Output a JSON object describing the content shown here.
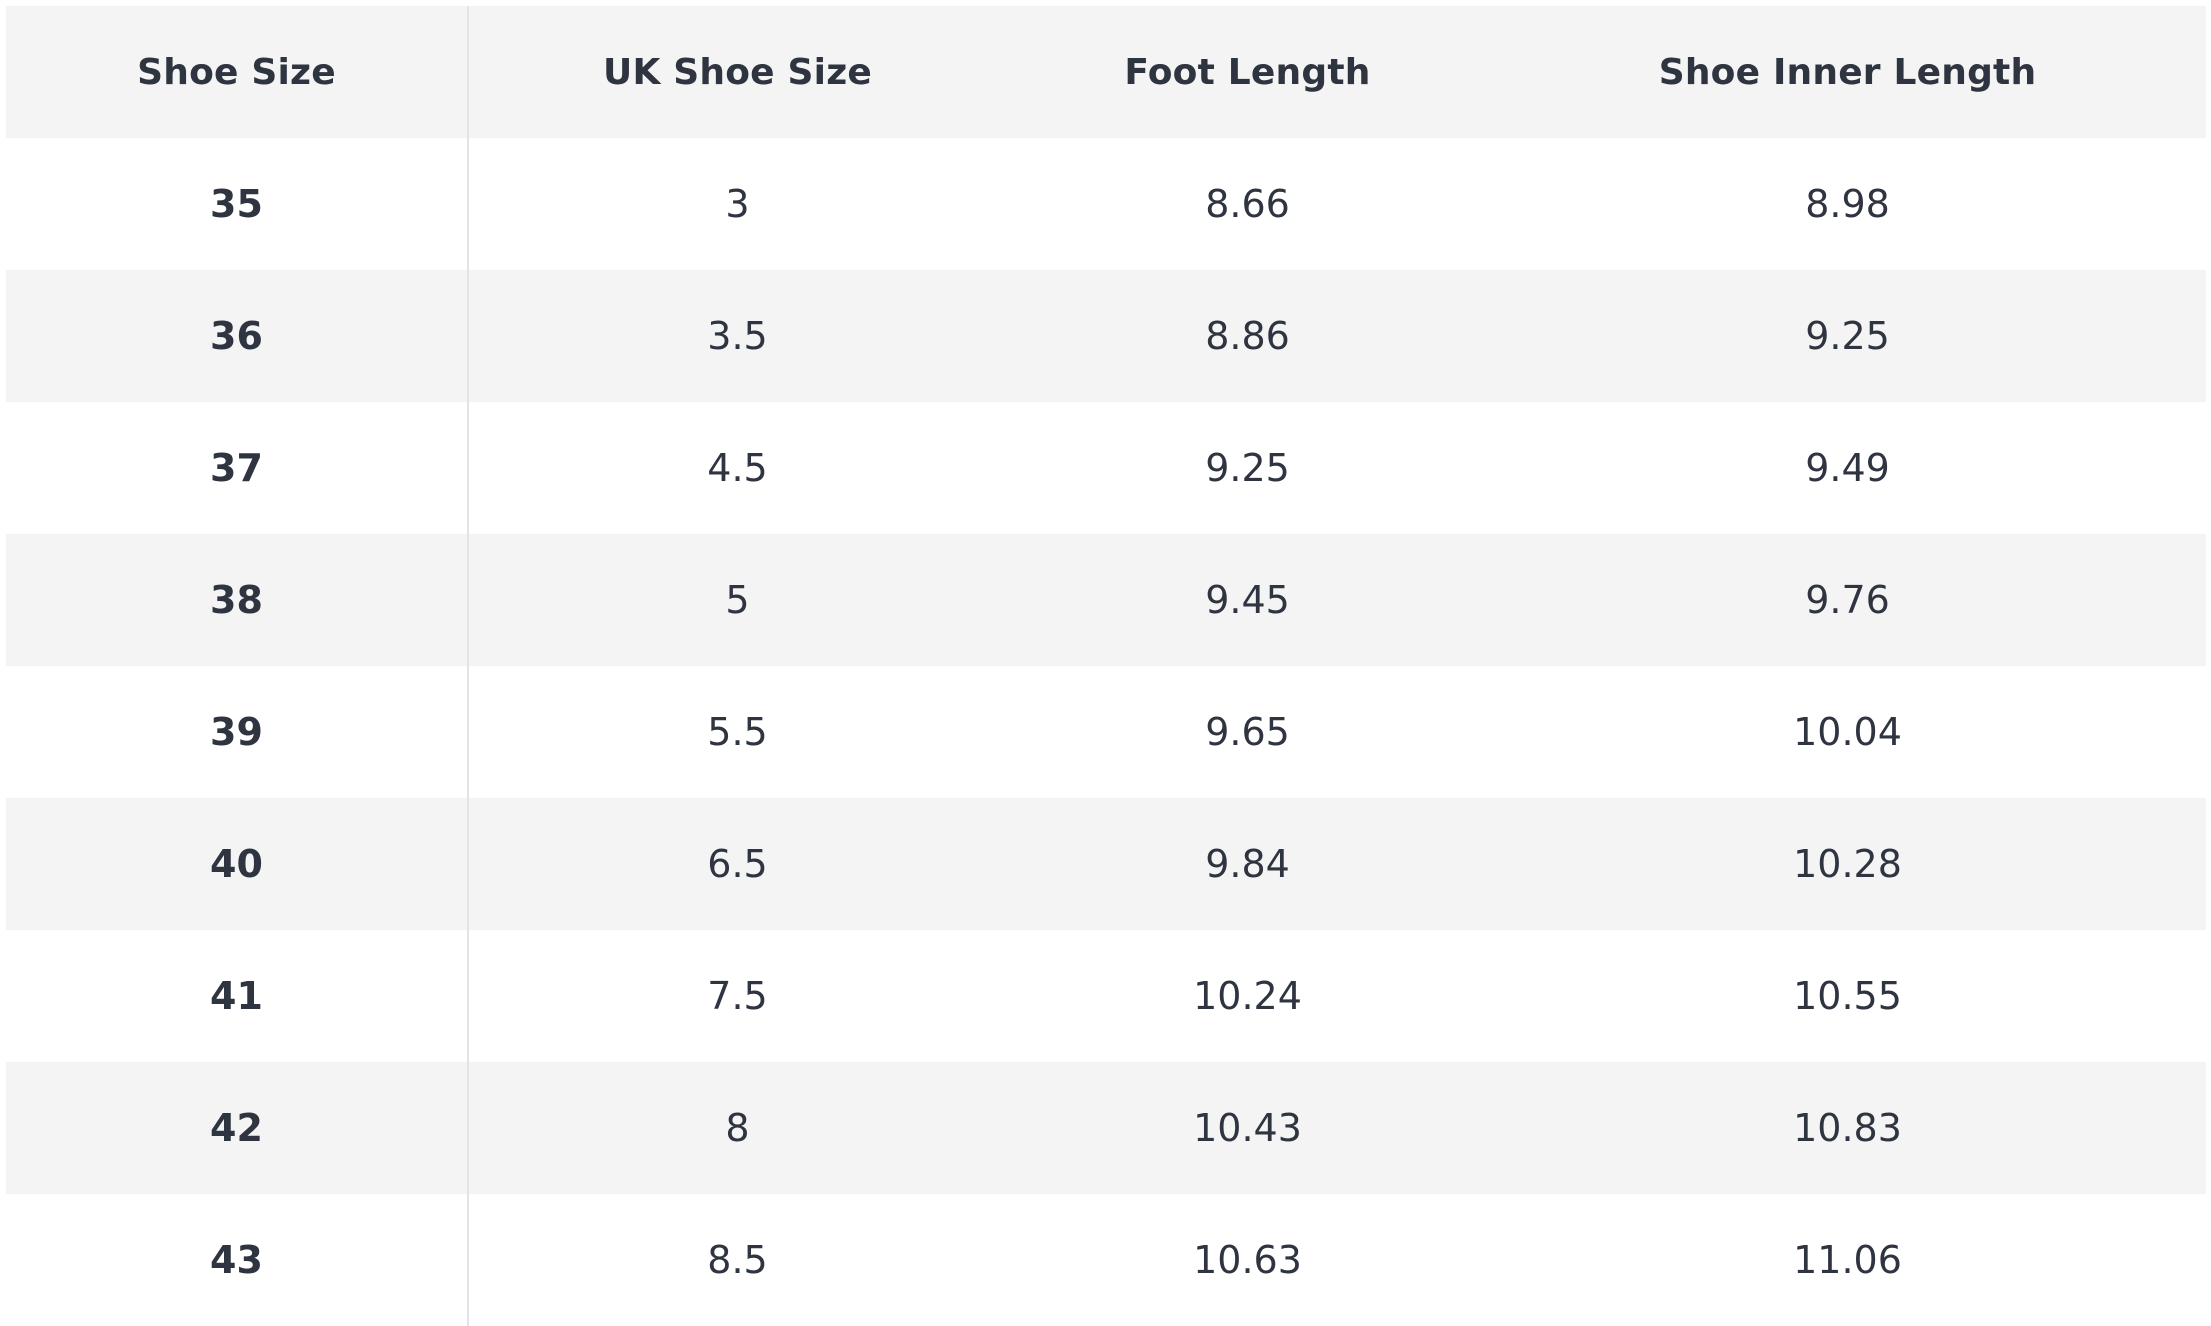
{
  "table": {
    "headers": [
      "Shoe Size",
      "UK Shoe Size",
      "Foot Length",
      "Shoe Inner Length"
    ],
    "rows": [
      [
        "35",
        "3",
        "8.66",
        "8.98"
      ],
      [
        "36",
        "3.5",
        "8.86",
        "9.25"
      ],
      [
        "37",
        "4.5",
        "9.25",
        "9.49"
      ],
      [
        "38",
        "5",
        "9.45",
        "9.76"
      ],
      [
        "39",
        "5.5",
        "9.65",
        "10.04"
      ],
      [
        "40",
        "6.5",
        "9.84",
        "10.28"
      ],
      [
        "41",
        "7.5",
        "10.24",
        "10.55"
      ],
      [
        "42",
        "8",
        "10.43",
        "10.83"
      ],
      [
        "43",
        "8.5",
        "10.63",
        "11.06"
      ]
    ]
  },
  "colors": {
    "text": "#2f3441",
    "stripe": "#f4f4f4",
    "divider": "#e2e4e8"
  }
}
